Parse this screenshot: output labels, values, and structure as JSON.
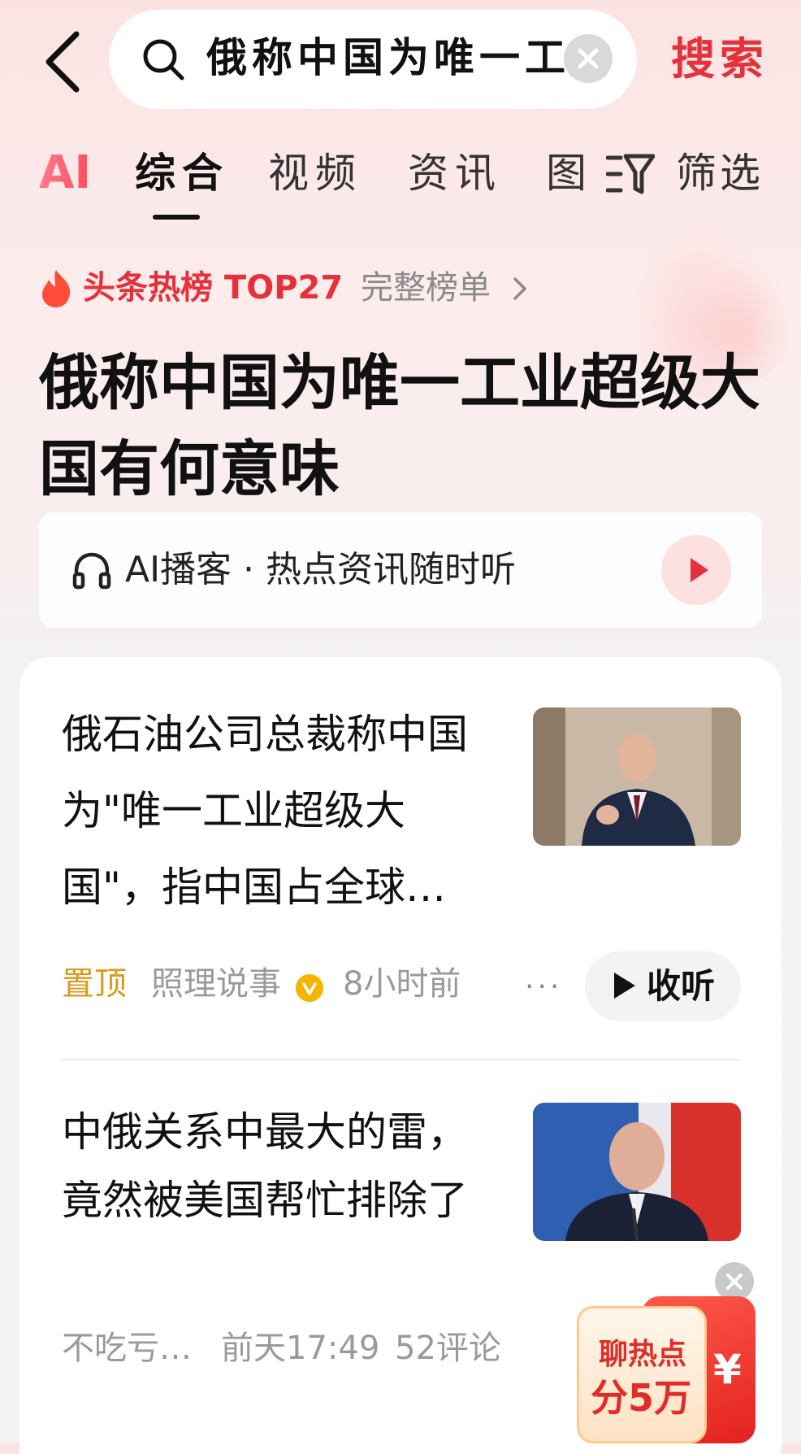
{
  "search": {
    "query": "俄称中国为唯一工",
    "button_label": "搜索"
  },
  "tabs": {
    "ai_label": "AI",
    "items": [
      {
        "label": "综合",
        "active": true
      },
      {
        "label": "视频",
        "active": false
      },
      {
        "label": "资讯",
        "active": false
      },
      {
        "label": "图",
        "active": false
      }
    ],
    "filter_label": "筛选"
  },
  "hot": {
    "tag": "头条热榜 TOP27",
    "full_list_label": "完整榜单",
    "headline": "俄称中国为唯一工业超级大国有何意味"
  },
  "podcast": {
    "label": "AI播客 · 热点资讯随时听"
  },
  "articles": [
    {
      "title": "俄石油公司总裁称中国为\"唯一工业超级大国\"，指中国占全球…",
      "pin": "置顶",
      "source": "照理说事",
      "time": "8小时前",
      "more": "···",
      "listen_label": "收听",
      "thumbnail_subject": "suited-man-gesturing"
    },
    {
      "title": "中俄关系中最大的雷，竟然被美国帮忙排除了",
      "source": "不吃亏…",
      "time": "前天17:49",
      "comments": "52评论",
      "thumbnail_subject": "man-with-microphone-flag-background"
    }
  ],
  "promo": {
    "line1": "聊热点",
    "line2": "分5万",
    "currency": "¥"
  },
  "colors": {
    "accent_red": "#e5323a",
    "pin_gold": "#d89a1c",
    "meta_gray": "#9a9a9a"
  }
}
